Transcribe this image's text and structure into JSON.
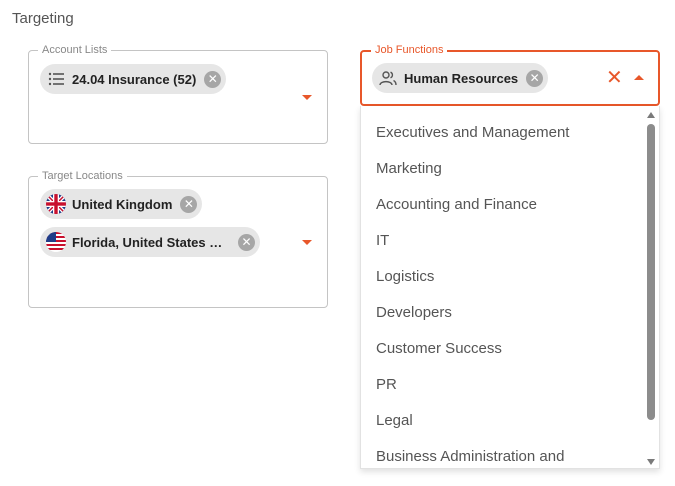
{
  "section": {
    "title": "Targeting"
  },
  "account_lists": {
    "legend": "Account Lists",
    "chips": [
      {
        "label": "24.04 Insurance (52)",
        "icon": "list-icon"
      }
    ]
  },
  "job_functions": {
    "legend": "Job Functions",
    "chips": [
      {
        "label": "Human Resources",
        "icon": "people-icon"
      }
    ],
    "options": [
      "Executives and Management",
      "Marketing",
      "Accounting and Finance",
      "IT",
      "Logistics",
      "Developers",
      "Customer Success",
      "PR",
      "Legal",
      "Business Administration and"
    ]
  },
  "target_locations": {
    "legend": "Target Locations",
    "chips": [
      {
        "label": "United Kingdom",
        "icon": "uk-flag-icon"
      },
      {
        "label": "Florida, United States of ...",
        "icon": "us-flag-icon"
      }
    ]
  },
  "colors": {
    "accent": "#e8572a",
    "chip_bg": "#e6e6e6",
    "border": "#c4c4c4"
  }
}
